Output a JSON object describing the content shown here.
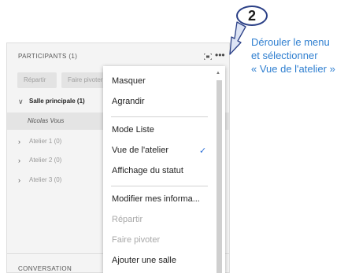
{
  "panel": {
    "title": "PARTICIPANTS  (1)",
    "buttons": {
      "assign": "Répartir",
      "rotate": "Faire pivoter"
    },
    "rooms": {
      "main": "Salle principale (1)",
      "user": "Nicolas Vous",
      "atelier1": "Atelier 1 (0)",
      "atelier2": "Atelier 2 (0)",
      "atelier3": "Atelier 3 (0)"
    },
    "conversation_title": "CONVERSATION"
  },
  "menu": {
    "hide": "Masquer",
    "maximize": "Agrandir",
    "list_mode": "Mode Liste",
    "breakout_view": "Vue de l'atelier",
    "status_display": "Affichage du statut",
    "edit_info": "Modifier mes informa...",
    "assign": "Répartir",
    "rotate": "Faire pivoter",
    "add_room": "Ajouter une salle"
  },
  "callout": {
    "number": "2",
    "line1": "Dérouler le menu",
    "line2": "et sélectionner",
    "line3": "« Vue de l'atelier »"
  },
  "colors": {
    "callout_text": "#2f7fd0",
    "check": "#2b6fd8",
    "panel_bg": "#f4f4f4"
  }
}
